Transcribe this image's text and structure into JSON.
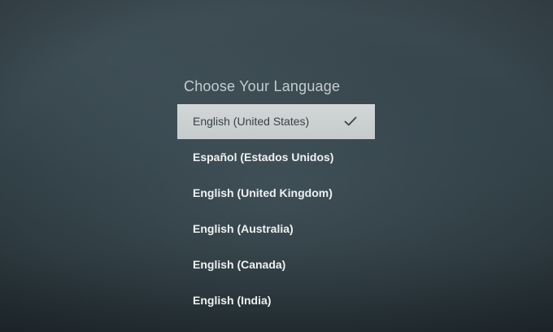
{
  "screen": {
    "heading": "Choose Your Language"
  },
  "languages": [
    {
      "label": "English (United States)",
      "selected": true
    },
    {
      "label": "Español (Estados Unidos)",
      "selected": false
    },
    {
      "label": "English (United Kingdom)",
      "selected": false
    },
    {
      "label": "English (Australia)",
      "selected": false
    },
    {
      "label": "English (Canada)",
      "selected": false
    },
    {
      "label": "English (India)",
      "selected": false
    }
  ],
  "icons": {
    "selected_marker": "checkmark-icon"
  },
  "colors": {
    "background": "#34434a",
    "highlight": "#cfd3d4",
    "highlight_text": "#3a4245",
    "item_text": "#eef1f2",
    "heading_text": "#c4cccf"
  }
}
